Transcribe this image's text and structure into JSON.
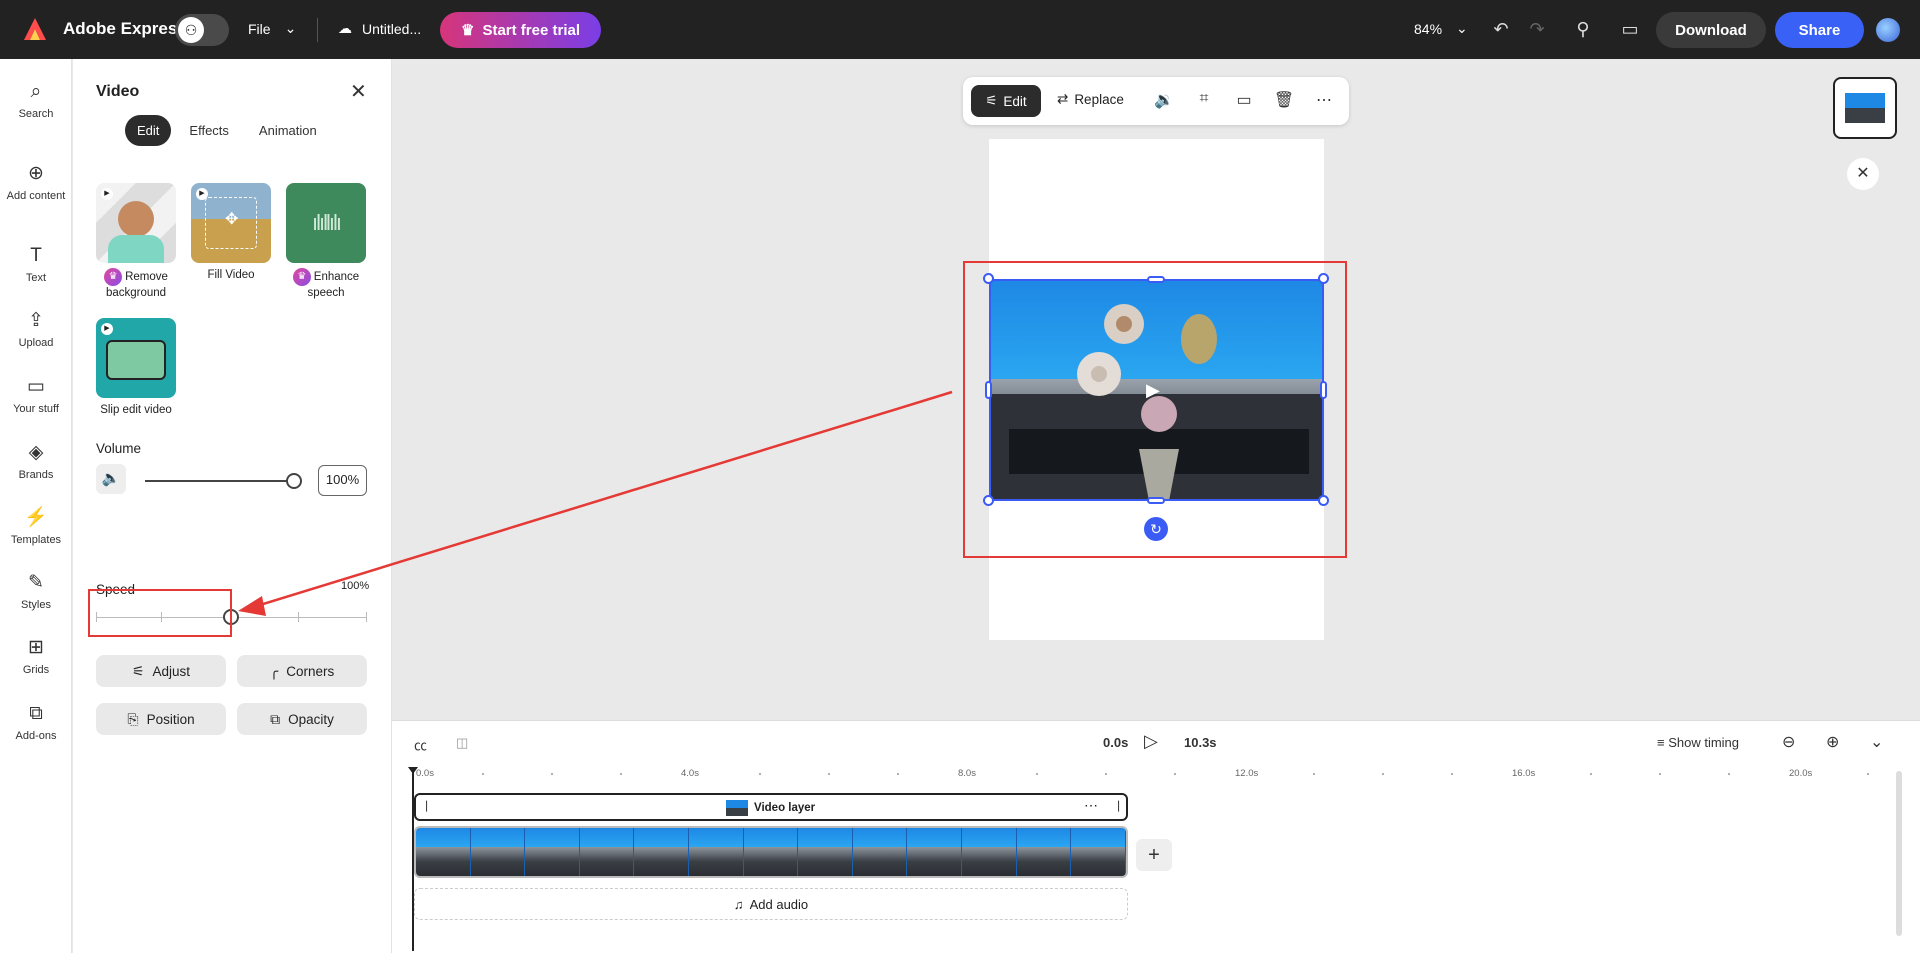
{
  "topbar": {
    "brand": "Adobe Express",
    "file_menu": "File",
    "doc_title": "Untitled...",
    "trial_button": "Start free trial",
    "zoom": "84%",
    "download": "Download",
    "share": "Share"
  },
  "rail": {
    "items": [
      {
        "label": "Search",
        "icon": "search-icon"
      },
      {
        "label": "Add content",
        "icon": "plus-circle-icon"
      },
      {
        "label": "Text",
        "icon": "text-icon"
      },
      {
        "label": "Upload",
        "icon": "upload-icon"
      },
      {
        "label": "Your stuff",
        "icon": "folder-icon"
      },
      {
        "label": "Brands",
        "icon": "brand-icon"
      },
      {
        "label": "Templates",
        "icon": "templates-icon"
      },
      {
        "label": "Styles",
        "icon": "styles-icon"
      },
      {
        "label": "Grids",
        "icon": "grid-icon"
      },
      {
        "label": "Add-ons",
        "icon": "addons-icon"
      }
    ]
  },
  "panel": {
    "title": "Video",
    "tabs": [
      "Edit",
      "Effects",
      "Animation"
    ],
    "active_tab": "Edit",
    "features": [
      {
        "label": "Remove background",
        "premium": true
      },
      {
        "label": "Fill Video",
        "premium": false
      },
      {
        "label": "Enhance speech",
        "premium": true
      },
      {
        "label": "Slip edit video",
        "premium": false
      }
    ],
    "volume_label": "Volume",
    "volume_value": "100%",
    "volume_level": 1.0,
    "speed_label": "Speed",
    "speed_value": "100%",
    "buttons": {
      "adjust": "Adjust",
      "corners": "Corners",
      "position": "Position",
      "opacity": "Opacity"
    }
  },
  "context_toolbar": {
    "edit": "Edit",
    "replace": "Replace"
  },
  "timeline": {
    "current_time": "0.0s",
    "duration": "10.3s",
    "show_timing": "Show timing",
    "ruler_labels": [
      "0.0s",
      "4.0s",
      "8.0s",
      "12.0s",
      "16.0s",
      "20.0s"
    ],
    "layer_name": "Video layer",
    "add_audio": "Add audio"
  },
  "colors": {
    "accent": "#3a61f6",
    "highlight": "#e53935",
    "topbar_bg": "#222222"
  }
}
